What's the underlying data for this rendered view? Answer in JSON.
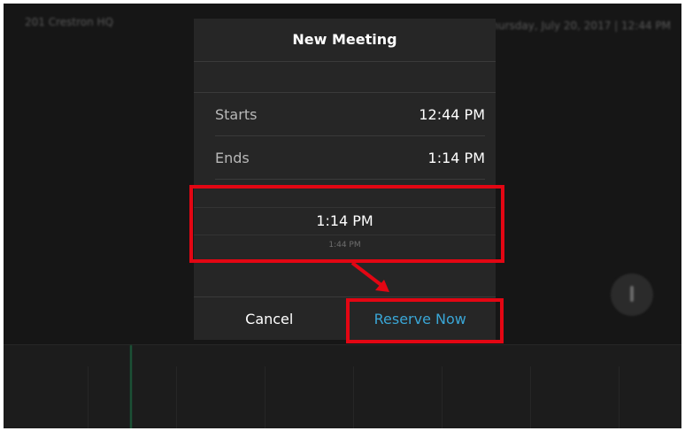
{
  "background": {
    "room_name": "201 Crestron HQ",
    "datetime": "Thursday, July 20, 2017 | 12:44 PM"
  },
  "dialog": {
    "title": "New Meeting",
    "starts_label": "Starts",
    "starts_value": "12:44 PM",
    "ends_label": "Ends",
    "ends_value": "1:14 PM",
    "picker": {
      "selected": "1:14 PM",
      "next": "1:44 PM"
    },
    "cancel_label": "Cancel",
    "reserve_label": "Reserve Now"
  },
  "colors": {
    "highlight": "#e30613",
    "accent": "#3aa6d6",
    "dialog_bg": "#262626"
  }
}
